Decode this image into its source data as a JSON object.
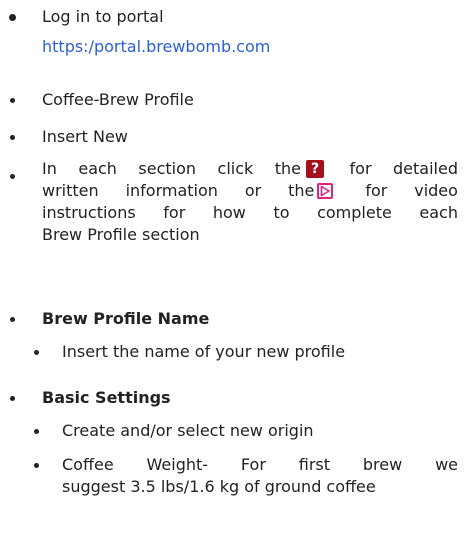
{
  "steps": {
    "login": "Log in to portal",
    "login_url": "https:/portal.brewbomb.com",
    "coffee_brew_profile": "Coffee-Brew Profile",
    "insert_new": "Insert New",
    "help": {
      "l1a": "In",
      "l1b": "each",
      "l1c": "section",
      "l1d": "click",
      "l1e": "the",
      "l1f": "for",
      "l1g": "detailed",
      "l2a": "written",
      "l2b": "information",
      "l2c": "or",
      "l2d": "the",
      "l2e": "for",
      "l2f": "video",
      "l3a": "instructions",
      "l3b": "for",
      "l3c": "how",
      "l3d": "to",
      "l3e": "complete",
      "l3f": "each",
      "l4": "Brew Profile section",
      "help_icon_glyph": "?",
      "help_icon_color": "#a3101b",
      "video_icon_color": "#e0247e"
    }
  },
  "sections": {
    "brew_profile_name": {
      "heading": "Brew Profile Name",
      "item1": "Insert the name of your new profile"
    },
    "basic_settings": {
      "heading": "Basic Settings",
      "item1": "Create and/or select new origin",
      "item2": {
        "l1a": "Coffee",
        "l1b": "Weight-",
        "l1c": "For",
        "l1d": "first",
        "l1e": "brew",
        "l1f": "we",
        "l2": "suggest 3.5 lbs/1.6 kg of ground coffee"
      }
    }
  },
  "colors": {
    "text": "#222222",
    "link": "#2b5fd6"
  }
}
